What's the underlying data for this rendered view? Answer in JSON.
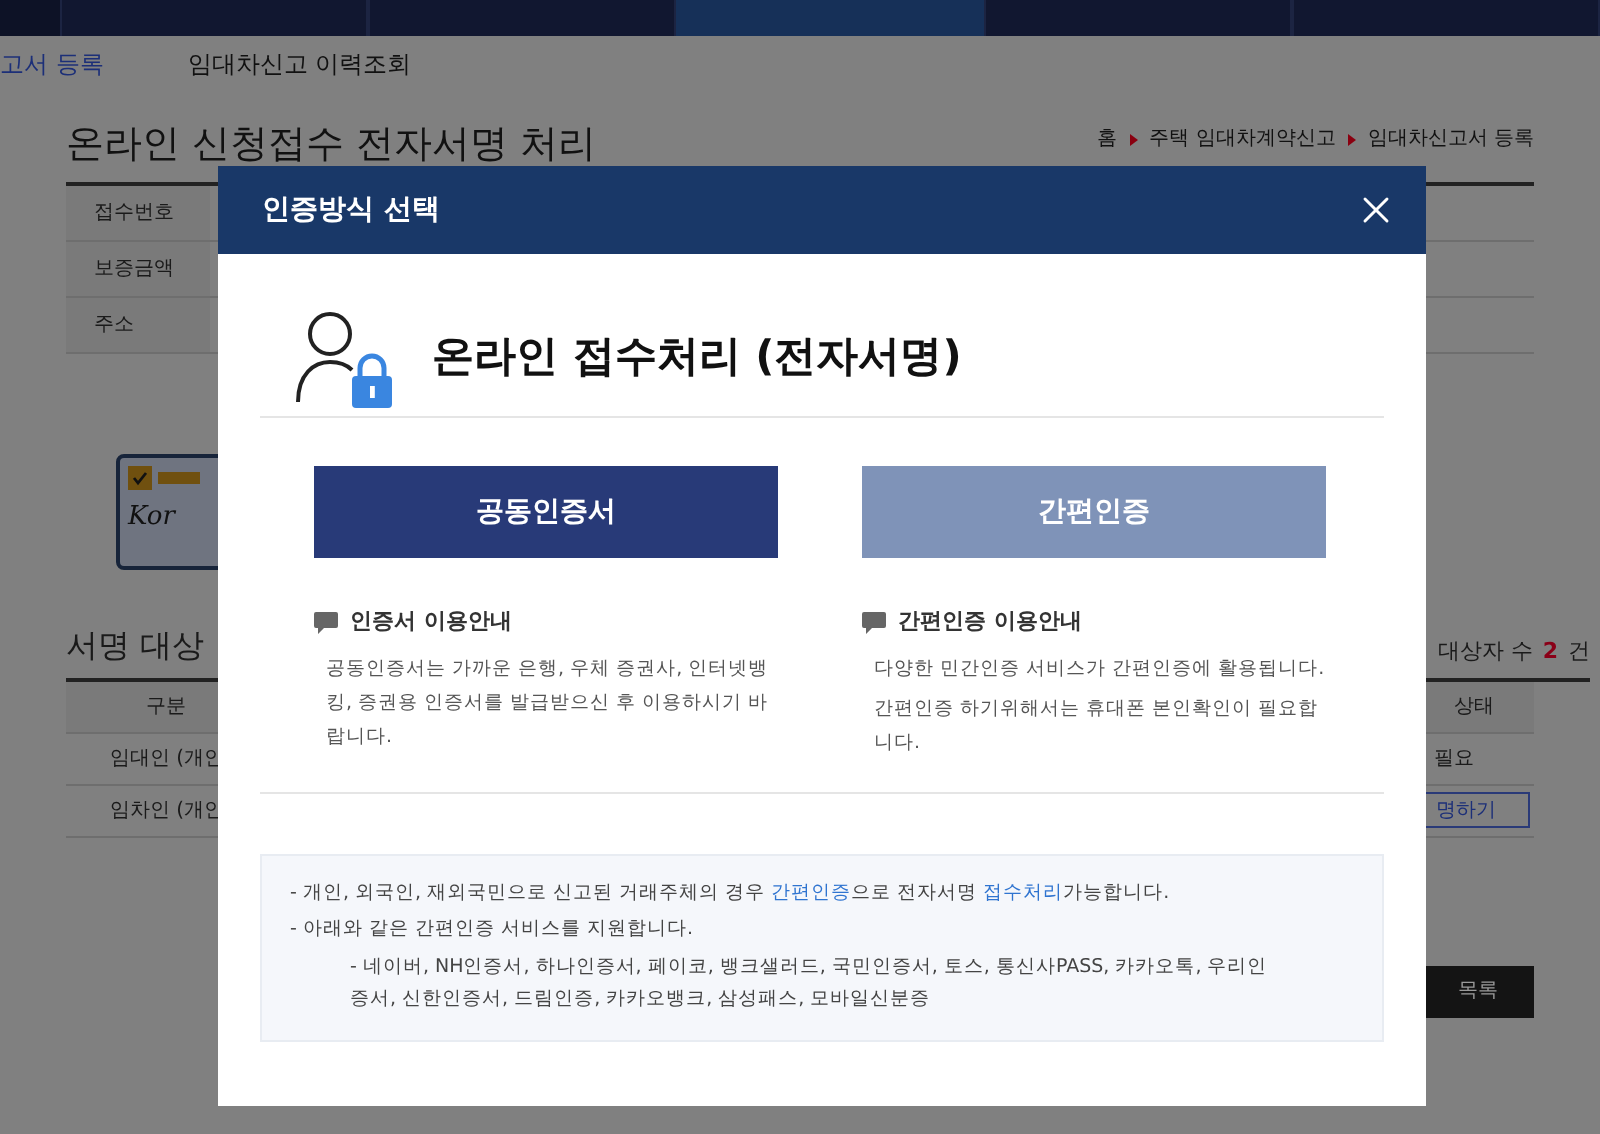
{
  "top_nav": {
    "tabs": [
      {
        "selected": false
      },
      {
        "selected": false
      },
      {
        "selected": true
      },
      {
        "selected": false
      },
      {
        "selected": false
      }
    ]
  },
  "sub_nav": [
    {
      "label": "고서 등록",
      "selected": true
    },
    {
      "label": "임대차신고 이력조회",
      "selected": false
    }
  ],
  "page_title": "온라인 신청접수 전자서명 처리",
  "breadcrumb": [
    "홈",
    "주택 임대차계약신고",
    "임대차신고서 등록"
  ],
  "form_labels": [
    "접수번호",
    "보증금액",
    "주소"
  ],
  "card_text": "Kor",
  "signers": {
    "title": "서명 대상",
    "count_label": "대상자 수",
    "count": "2",
    "count_unit": "건",
    "column_1": "구분",
    "column_2": "상태",
    "rows": [
      {
        "kind": "status",
        "type": "임대인 (개인",
        "value": "필요"
      },
      {
        "kind": "button",
        "type": "임차인 (개인",
        "value": "명하기"
      }
    ]
  },
  "list_button": "목록",
  "modal": {
    "title": "인증방식 선택",
    "heading": "온라인 접수처리 (전자서명)",
    "options": [
      {
        "label": "공동인증서",
        "selected": true,
        "guide_title": "인증서 이용안내",
        "guide_lines": [
          "공동인증서는 가까운 은행, 우체 증권사, 인터넷뱅킹, 증권용 인증서를 발급받으신 후 이용하시기 바랍니다."
        ]
      },
      {
        "label": "간편인증",
        "selected": false,
        "guide_title": "간편인증 이용안내",
        "guide_lines": [
          "다양한 민간인증 서비스가 간편인증에 활용됩니다.",
          "간편인증 하기위해서는 휴대폰 본인확인이 필요합니다."
        ]
      }
    ],
    "notice": [
      {
        "bullet": "-",
        "segments": [
          {
            "text": "개인, 외국인, 재외국민으로 신고된 거래주체의 경우 ",
            "link": false
          },
          {
            "text": "간편인증",
            "link": true
          },
          {
            "text": "으로 전자서명 ",
            "link": false
          },
          {
            "text": "접수처리",
            "link": true
          },
          {
            "text": "가능합니다.",
            "link": false
          }
        ]
      },
      {
        "bullet": "-",
        "segments": [
          {
            "text": "아래와 같은 간편인증 서비스를 지원합니다.",
            "link": false
          }
        ]
      }
    ],
    "services": "- 네이버, NH인증서, 하나인증서, 페이코, 뱅크샐러드, 국민인증서, 토스, 통신사PASS, 카카오톡, 우리인증서, 신한인증서, 드림인증, 카카오뱅크, 삼성패스, 모바일신분증"
  }
}
